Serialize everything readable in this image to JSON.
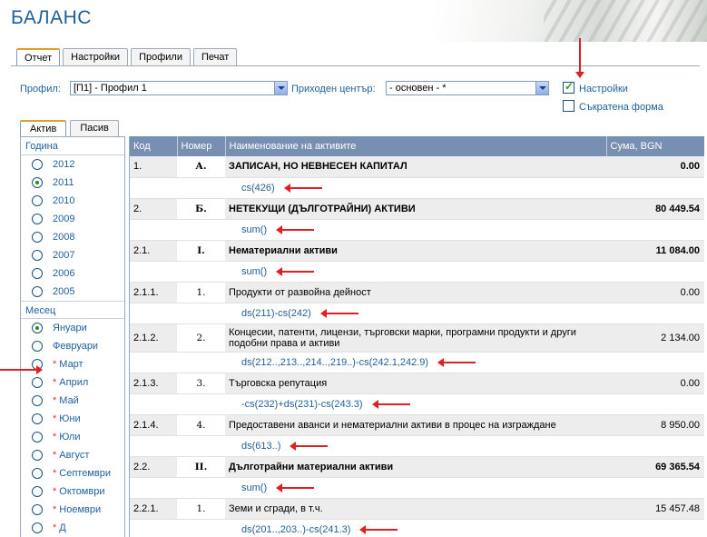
{
  "header": {
    "title": "БАЛАНС"
  },
  "main_tabs": [
    {
      "label": "Отчет",
      "active": true
    },
    {
      "label": "Настройки",
      "active": false
    },
    {
      "label": "Профили",
      "active": false
    },
    {
      "label": "Печат",
      "active": false
    }
  ],
  "filters": {
    "profile_label": "Профил:",
    "profile_value": "[П1] - Профил 1",
    "center_label": "Приходен център:",
    "center_value": "- основен - *",
    "settings_checkbox": {
      "label": "Настройки",
      "checked": true
    },
    "short_form_checkbox": {
      "label": "Съкратена форма",
      "checked": false
    }
  },
  "sub_tabs": [
    {
      "label": "Актив",
      "active": true
    },
    {
      "label": "Пасив",
      "active": false
    }
  ],
  "left_panel": {
    "year_title": "Година",
    "years": [
      {
        "label": "2012",
        "checked": false
      },
      {
        "label": "2011",
        "checked": true
      },
      {
        "label": "2010",
        "checked": false
      },
      {
        "label": "2009",
        "checked": false
      },
      {
        "label": "2008",
        "checked": false
      },
      {
        "label": "2007",
        "checked": false
      },
      {
        "label": "2006",
        "checked": false
      },
      {
        "label": "2005",
        "checked": false
      }
    ],
    "month_title": "Месец",
    "months": [
      {
        "label": "Януари",
        "checked": true,
        "star": false
      },
      {
        "label": "Февруари",
        "checked": false,
        "star": false
      },
      {
        "label": "Март",
        "checked": false,
        "star": true
      },
      {
        "label": "Април",
        "checked": false,
        "star": true
      },
      {
        "label": "Май",
        "checked": false,
        "star": true
      },
      {
        "label": "Юни",
        "checked": false,
        "star": true
      },
      {
        "label": "Юли",
        "checked": false,
        "star": true
      },
      {
        "label": "Август",
        "checked": false,
        "star": true
      },
      {
        "label": "Септември",
        "checked": false,
        "star": true
      },
      {
        "label": "Октомври",
        "checked": false,
        "star": true
      },
      {
        "label": "Ноември",
        "checked": false,
        "star": true
      },
      {
        "label": "Д",
        "checked": false,
        "star": true
      }
    ]
  },
  "table": {
    "columns": [
      "Код",
      "Номер",
      "Наименование на активите",
      "Сума, BGN"
    ],
    "rows": [
      {
        "code": "1.",
        "num": "А.",
        "name": "ЗАПИСАН, НО НЕВНЕСЕН КАПИТАЛ",
        "sum": "0.00",
        "bold": true,
        "formula": "cs(426)"
      },
      {
        "code": "2.",
        "num": "Б.",
        "name": "НЕТЕКУЩИ (ДЪЛГОТРАЙНИ) АКТИВИ",
        "sum": "80 449.54",
        "bold": true,
        "formula": "sum()"
      },
      {
        "code": "2.1.",
        "num": "I.",
        "name": "Нематериални активи",
        "sum": "11 084.00",
        "bold": true,
        "formula": "sum()"
      },
      {
        "code": "2.1.1.",
        "num": "1.",
        "name": "Продукти от развойна дейност",
        "sum": "0.00",
        "bold": false,
        "formula": "ds(211)-cs(242)"
      },
      {
        "code": "2.1.2.",
        "num": "2.",
        "name": "Концесии, патенти, лицензи, търговски марки, програмни продукти и други подобни права и активи",
        "sum": "2 134.00",
        "bold": false,
        "formula": "ds(212..,213..,214..,219..)-cs(242.1,242.9)"
      },
      {
        "code": "2.1.3.",
        "num": "3.",
        "name": "Търговска репутация",
        "sum": "0.00",
        "bold": false,
        "formula": "-cs(232)+ds(231)-cs(243.3)"
      },
      {
        "code": "2.1.4.",
        "num": "4.",
        "name": "Предоставени аванси и нематериални активи в процес на изграждане",
        "sum": "8 950.00",
        "bold": false,
        "formula": "ds(613..)"
      },
      {
        "code": "2.2.",
        "num": "II.",
        "name": "Дълготрайни материални активи",
        "sum": "69 365.54",
        "bold": true,
        "formula": "sum()"
      },
      {
        "code": "2.2.1.",
        "num": "1.",
        "name": "Земи и сгради, в т.ч.",
        "sum": "15 457.48",
        "bold": false,
        "formula": "ds(201..,203..)-cs(241.3)"
      }
    ]
  },
  "colors": {
    "accent_blue": "#1f5f99",
    "grid_header": "#778fb1",
    "annotation_red": "#e02020"
  }
}
